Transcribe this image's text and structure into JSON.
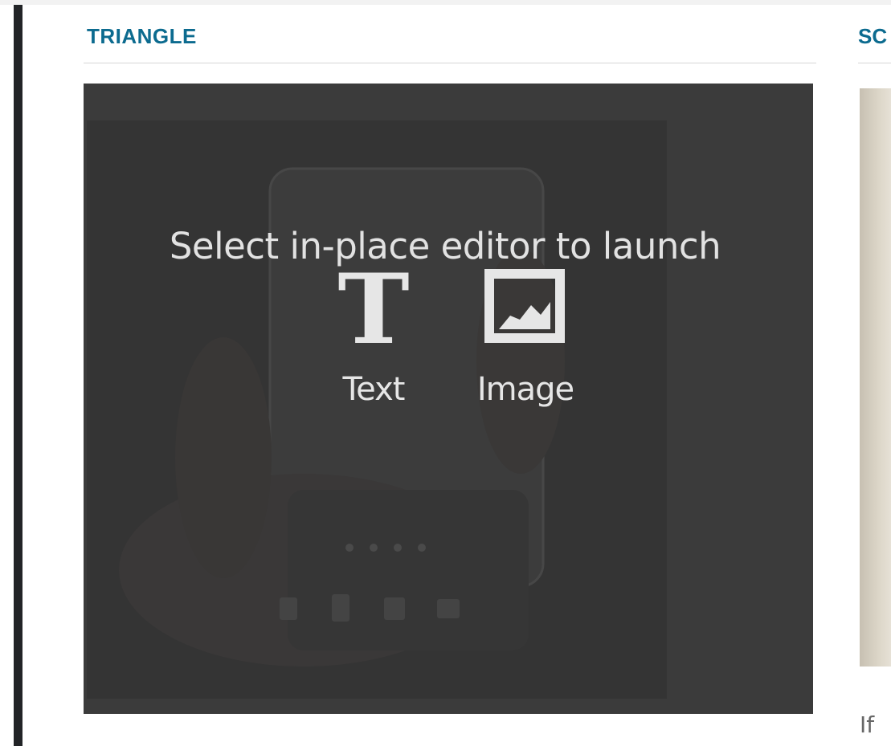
{
  "main": {
    "section_title": "TRIANGLE"
  },
  "overlay": {
    "heading": "Select in-place editor to launch",
    "options": [
      {
        "label": "Text",
        "icon": "text-icon"
      },
      {
        "label": "Image",
        "icon": "image-icon"
      }
    ]
  },
  "right_card": {
    "title": "SC",
    "snippet": "If"
  },
  "colors": {
    "accent": "#0c6b8f",
    "overlay_background": "#3b3b3b",
    "overlay_text": "#e6e6e6",
    "left_bar": "#222427"
  }
}
